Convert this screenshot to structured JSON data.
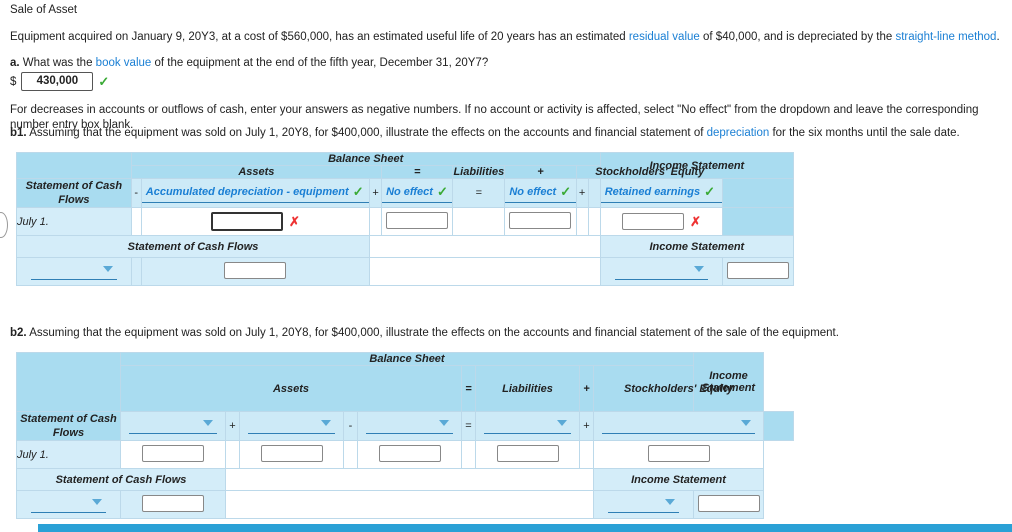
{
  "header": {
    "title": "Sale of Asset"
  },
  "intro": {
    "line1_pre": "Equipment acquired on January 9, 20Y3, at a cost of $560,000, has an estimated useful life of 20 years has an estimated ",
    "line1_link1": "residual value",
    "line1_mid": " of $40,000, and is depreciated by the ",
    "line1_link2": "straight-line method",
    "line1_post": "."
  },
  "part_a": {
    "label": "a.",
    "question_pre": "What was the ",
    "question_link": "book value",
    "question_post": " of the equipment at the end of the fifth year, December 31, 20Y7?",
    "dollar": "$",
    "answer": "430,000",
    "status_icon": "check-icon"
  },
  "instructions": "For decreases in accounts or outflows of cash, enter your answers as negative numbers. If no account or activity is affected, select \"No effect\" from the dropdown and leave the corresponding number entry box blank.",
  "part_b1": {
    "label": "b1.",
    "text_pre": "Assuming that the equipment was sold on July 1, 20Y8, for $400,000, illustrate the effects on the accounts and financial statement of ",
    "text_link": "depreciation",
    "text_post": " for the six months until the sale date.",
    "table": {
      "balance_sheet_header": "Balance Sheet",
      "col_statement_of_cash_flows": "Statement of Cash Flows",
      "col_assets": "Assets",
      "col_equals": "=",
      "col_liabilities": "Liabilities",
      "col_plus1": "+",
      "col_stockholders_equity": "Stockholders' Equity",
      "col_income_statement": "Income Statement",
      "minus_sign": "-",
      "plus_sign": "+",
      "eq_sign": "=",
      "plus_sign2": "+",
      "dd_assets": "Accumulated depreciation - equipment",
      "dd_assets_status": "check-icon",
      "dd_noeffect1": "No effect",
      "dd_noeffect1_status": "check-icon",
      "dd_noeffect2": "No effect",
      "dd_noeffect2_status": "check-icon",
      "dd_retained": "Retained earnings",
      "dd_retained_status": "check-icon",
      "row_date": "July 1.",
      "row_input_status": "cross-icon",
      "row_se_status": "cross-icon",
      "footer_scf": "Statement of Cash Flows",
      "footer_is": "Income Statement"
    }
  },
  "part_b2": {
    "label": "b2.",
    "text": "Assuming that the equipment was sold on July 1, 20Y8, for $400,000, illustrate the effects on the accounts and financial statement of the sale of the equipment.",
    "table": {
      "balance_sheet_header": "Balance Sheet",
      "col_statement_of_cash_flows": "Statement of Cash Flows",
      "col_assets": "Assets",
      "col_equals": "=",
      "col_liabilities": "Liabilities",
      "col_plus1": "+",
      "col_stockholders_equity": "Stockholders' Equity",
      "col_income_statement": "Income Statement",
      "plus_sign": "+",
      "minus_sign": "-",
      "eq_sign": "=",
      "plus_sign2": "+",
      "row_date": "July 1.",
      "footer_scf": "Statement of Cash Flows",
      "footer_is": "Income Statement"
    }
  }
}
